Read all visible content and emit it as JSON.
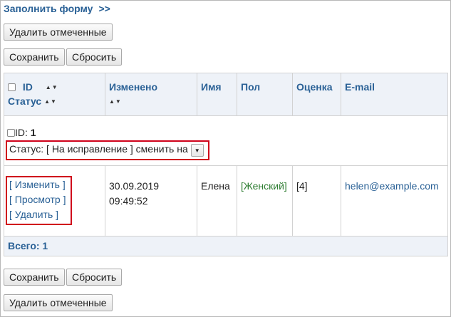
{
  "header": {
    "fill_form_label": "Заполнить форму",
    "fill_form_arrows": ">>"
  },
  "buttons": {
    "delete_selected": "Удалить отмеченные",
    "save": "Сохранить",
    "reset": "Сбросить"
  },
  "table": {
    "columns": {
      "id": "ID",
      "status": "Статус",
      "changed": "Изменено",
      "name": "Имя",
      "gender": "Пол",
      "score": "Оценка",
      "email": "E-mail"
    },
    "sort_glyph": "▲▼",
    "status_row": {
      "id_label": "ID:",
      "id_value": "1",
      "status_text": "Статус: [ На исправление ] сменить на",
      "select_arrow": "▼"
    },
    "row": {
      "actions": [
        "Изменить",
        "Просмотр",
        "Удалить"
      ],
      "date": "30.09.2019",
      "time": "09:49:52",
      "name": "Елена",
      "gender": "[Женский]",
      "score": "[4]",
      "email": "helen@example.com"
    },
    "total": "Всего: 1"
  }
}
